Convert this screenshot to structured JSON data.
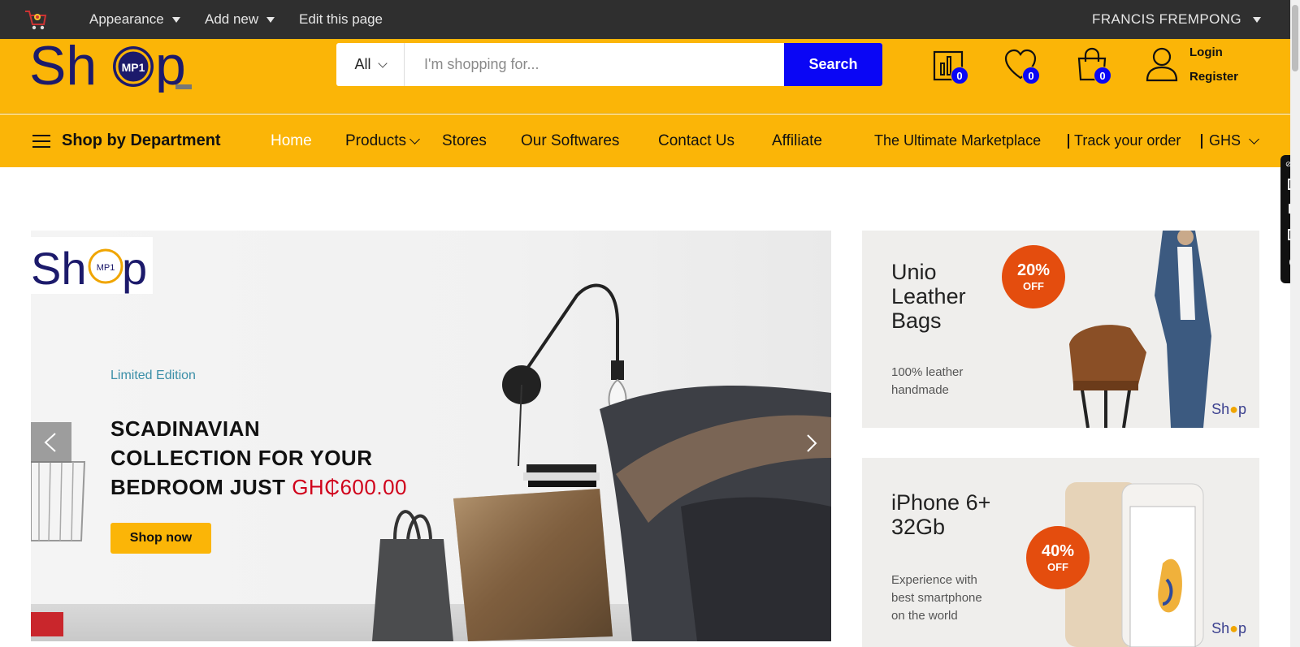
{
  "admin_bar": {
    "appearance_label": "Appearance",
    "add_new_label": "Add new",
    "edit_page_label": "Edit this page",
    "user_name": "FRANCIS FREMPONG"
  },
  "header": {
    "logo_text": "Sh",
    "logo_text_end": "p",
    "logo_badge": "MP1",
    "search": {
      "category": "All",
      "placeholder": "I'm shopping for...",
      "button_label": "Search"
    },
    "compare_count": "0",
    "wishlist_count": "0",
    "cart_count": "0",
    "login_label": "Login",
    "register_label": "Register"
  },
  "nav": {
    "department_label": "Shop by Department",
    "links": [
      "Home",
      "Products",
      "Stores",
      "Our Softwares",
      "Contact Us",
      "Affiliate"
    ],
    "right_links": [
      "The Ultimate Marketplace",
      "Track your order",
      "GHS"
    ]
  },
  "hero": {
    "logo_text": "Sh",
    "logo_text_end": "p",
    "logo_badge": "MP1",
    "tagline": "Limited Edition",
    "title_line1": "SCADINAVIAN",
    "title_line2": "COLLECTION FOR YOUR",
    "title_line3": "BEDROOM JUST ",
    "price": "GH₵600.00",
    "button_label": "Shop now"
  },
  "promos": [
    {
      "title_line1": "Unio",
      "title_line2": "Leather",
      "title_line3": "Bags",
      "sub_line1": "100% leather",
      "sub_line2": "handmade",
      "discount": "20%",
      "off": "OFF",
      "watermark": "Sh",
      "watermark_end": "p"
    },
    {
      "title_line1": "iPhone 6+",
      "title_line2": "32Gb",
      "sub_line1": "Experience with",
      "sub_line2": "best smartphone",
      "sub_line3": "on the world",
      "discount": "40%",
      "off": "OFF",
      "watermark": "Sh",
      "watermark_end": "p"
    }
  ],
  "colors": {
    "brand_yellow": "#fbb507",
    "search_blue": "#0a06f5",
    "admin_dark": "#2f2f2f",
    "logo_navy": "#1c1a6b",
    "discount_orange": "#e44d0e",
    "price_red": "#d0021b"
  }
}
